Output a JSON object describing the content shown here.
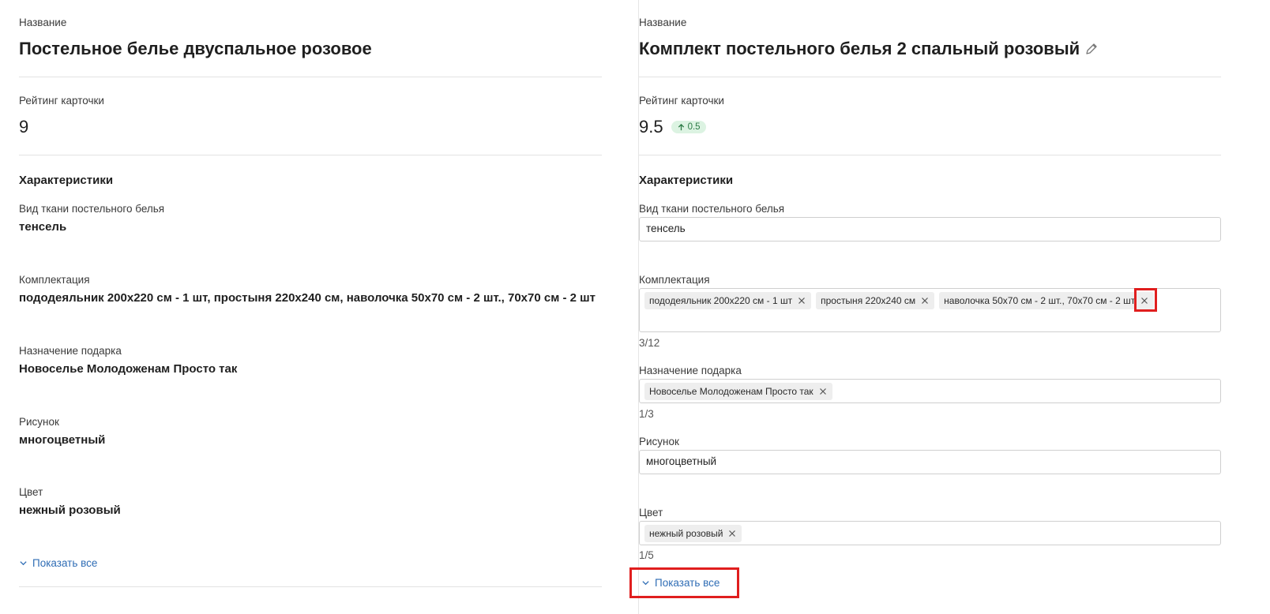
{
  "left": {
    "name_label": "Название",
    "name_value": "Постельное белье двуспальное розовое",
    "rating_label": "Рейтинг карточки",
    "rating_value": "9",
    "characteristics_title": "Характеристики",
    "fields": [
      {
        "label": "Вид ткани постельного белья",
        "value": "тенсель"
      },
      {
        "label": "Комплектация",
        "value": "пододеяльник 200x220 см - 1 шт, простыня 220x240 см, наволочка 50x70 см - 2 шт., 70x70 см - 2 шт"
      },
      {
        "label": "Назначение подарка",
        "value": "Новоселье Молодоженам Просто так"
      },
      {
        "label": "Рисунок",
        "value": "многоцветный"
      },
      {
        "label": "Цвет",
        "value": "нежный розовый"
      }
    ],
    "show_all": "Показать все"
  },
  "right": {
    "name_label": "Название",
    "name_value": "Комплект постельного белья 2 спальный розовый",
    "rating_label": "Рейтинг карточки",
    "rating_value": "9.5",
    "rating_delta": "0.5",
    "characteristics_title": "Характеристики",
    "fabric": {
      "label": "Вид ткани постельного белья",
      "value": "тенсель"
    },
    "complect": {
      "label": "Комплектация",
      "tags": [
        "пододеяльник 200x220 см - 1 шт",
        "простыня 220x240 см",
        "наволочка 50x70 см - 2 шт., 70x70 см - 2 шт"
      ],
      "counter": "3/12"
    },
    "gift": {
      "label": "Назначение подарка",
      "tags": [
        "Новоселье Молодоженам Просто так"
      ],
      "counter": "1/3"
    },
    "pattern": {
      "label": "Рисунок",
      "value": "многоцветный"
    },
    "color": {
      "label": "Цвет",
      "tags": [
        "нежный розовый"
      ],
      "counter": "1/5"
    },
    "show_all": "Показать все"
  },
  "colors": {
    "link": "#2f6db5",
    "badge_bg": "#dcf3e2",
    "badge_fg": "#2c7a45",
    "highlight": "#e01e1e"
  },
  "icons": [
    "chevron-down-icon",
    "arrow-up-icon",
    "pencil-icon",
    "close-icon"
  ]
}
